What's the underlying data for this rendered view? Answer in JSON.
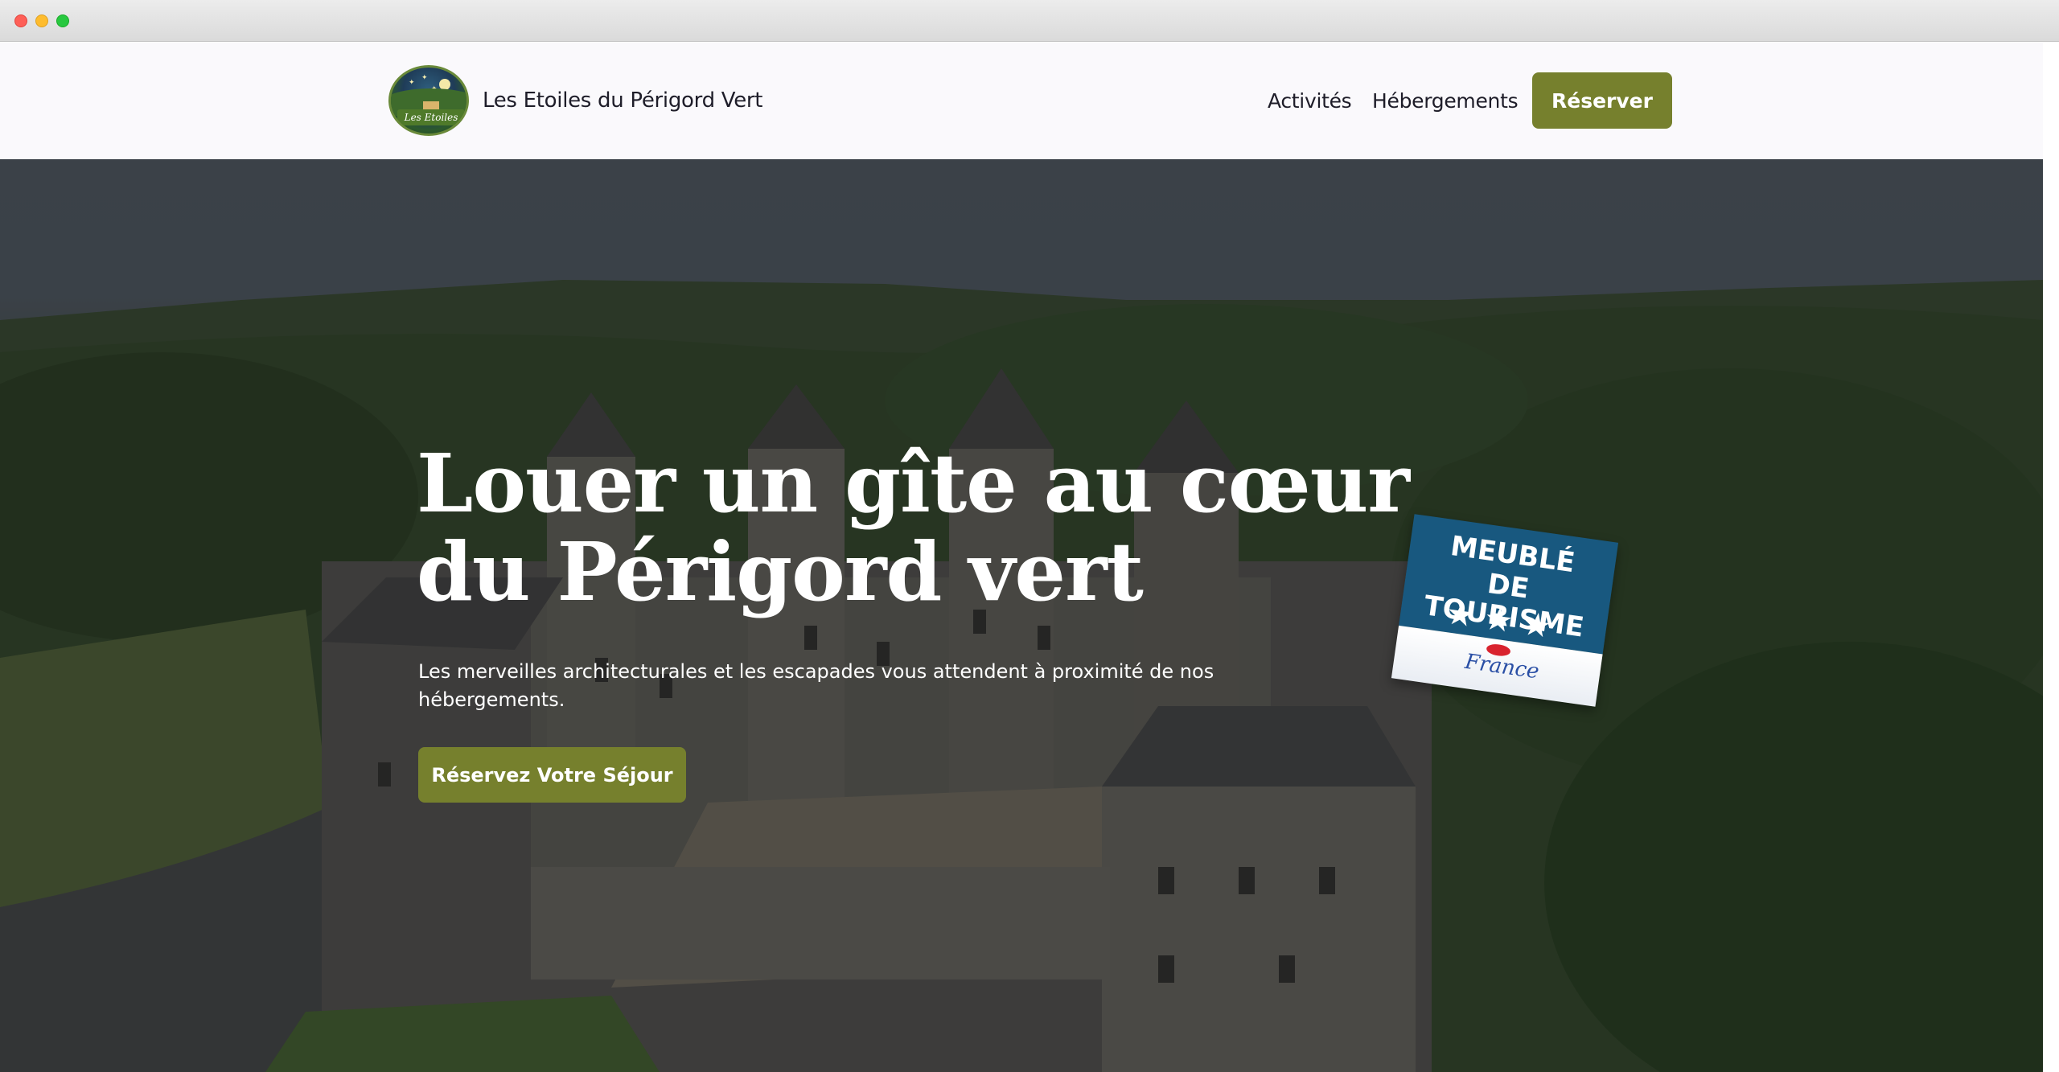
{
  "header": {
    "brand": "Les Etoiles du Périgord Vert",
    "logo_text": "Les Etoiles",
    "nav": [
      {
        "label": "Activités"
      },
      {
        "label": "Hébergements"
      }
    ],
    "cta_label": "Réserver"
  },
  "hero": {
    "title_line1": "Louer un gîte au cœur",
    "title_line2": "du Périgord vert",
    "subtitle": "Les merveilles architecturales et les escapades vous attendent à proximité de nos hébergements.",
    "cta_label": "Réservez Votre Séjour"
  },
  "badge": {
    "line1": "MEUBLÉ",
    "line2": "DE TOURISME",
    "stars": "★★★",
    "logo_text": "France"
  },
  "colors": {
    "accent": "#76802d",
    "text_dark": "#1e1d29",
    "badge_blue": "#18587f"
  }
}
